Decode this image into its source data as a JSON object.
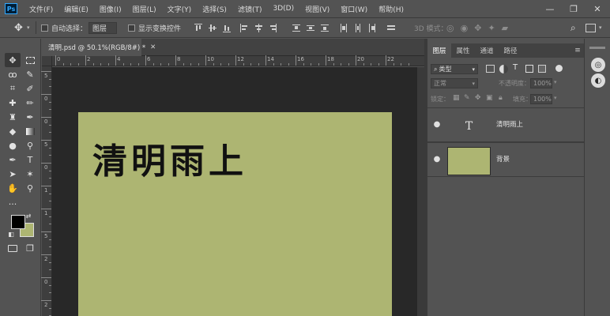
{
  "app": {
    "logo": "Ps"
  },
  "menu": [
    "文件(F)",
    "编辑(E)",
    "图像(I)",
    "图层(L)",
    "文字(Y)",
    "选择(S)",
    "滤镜(T)",
    "3D(D)",
    "视图(V)",
    "窗口(W)",
    "帮助(H)"
  ],
  "window_controls": {
    "minimize": "—",
    "restore": "❐",
    "close": "✕"
  },
  "options": {
    "auto_select_label": "自动选择：",
    "auto_select_target": "图层",
    "show_transform_label": "显示变换控件",
    "mode_3d_label": "3D 模式："
  },
  "document": {
    "tab_title": "清明.psd @ 50.1%(RGB/8#) *",
    "canvas_text": "清明雨上",
    "canvas_color": "#adb572",
    "ruler_top_labels": [
      "0",
      "2",
      "4",
      "6",
      "8",
      "10",
      "12",
      "14",
      "16",
      "18",
      "20",
      "22"
    ],
    "ruler_left_labels": [
      "5",
      "0",
      "0",
      "5",
      "0",
      "1",
      "1",
      "5",
      "2",
      "0",
      "2"
    ]
  },
  "layers_panel": {
    "tabs": [
      "图层",
      "属性",
      "通道",
      "路径"
    ],
    "filter_kind": "类型",
    "blend_mode": "正常",
    "opacity_label": "不透明度：",
    "opacity_value": "100%",
    "lock_label": "锁定：",
    "fill_label": "填充：",
    "fill_value": "100%",
    "layers": [
      {
        "name": "清明雨上",
        "kind": "text",
        "thumb_glyph": "T"
      },
      {
        "name": "背景",
        "kind": "image",
        "thumb_color": "#adb572"
      }
    ]
  }
}
